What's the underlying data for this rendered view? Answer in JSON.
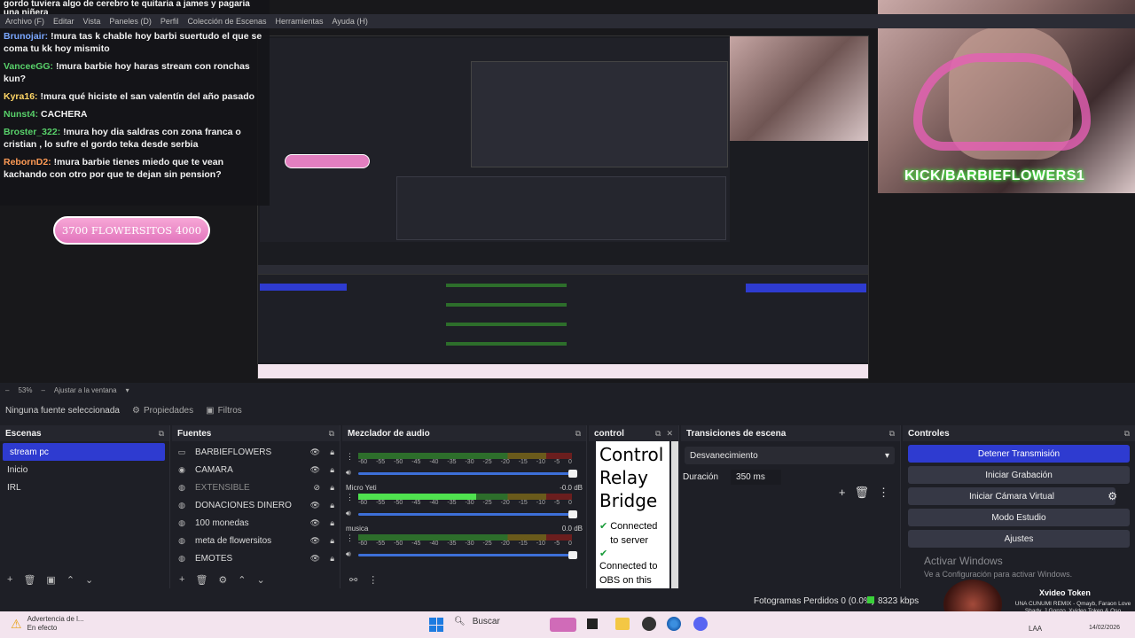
{
  "menubar": {
    "items": [
      "Archivo (F)",
      "Editar",
      "Vista",
      "Paneles (D)",
      "Perfil",
      "Colección de Escenas",
      "Herramientas",
      "Ayuda (H)"
    ]
  },
  "chat": {
    "top_fragment": "gordo tuviera algo de cerebro te quitaria a james y pagaria una niñera",
    "messages": [
      {
        "user": "Brunojair:",
        "user_color": "#7aa7ff",
        "text": "!mura tas k chable hoy barbi suertudo el que se coma tu kk hoy mismito"
      },
      {
        "user": "VanceeGG:",
        "user_color": "#58d16a",
        "text": "!mura barbie hoy haras stream con ronchas kun?"
      },
      {
        "user": "Kyra16:",
        "user_color": "#ffd666",
        "text": "!mura qué hiciste el san valentín del año pasado"
      },
      {
        "user": "Nunst4:",
        "user_color": "#58d16a",
        "text": "CACHERA"
      },
      {
        "user": "Broster_322:",
        "user_color": "#58d16a",
        "text": "!mura hoy dia saldras con zona franca o cristian , lo sufre el gordo teka desde serbia"
      },
      {
        "user": "RebornD2:",
        "user_color": "#ff9b55",
        "text": "!mura barbie tienes miedo que te vean kachando con otro por que te dejan sin pension?"
      }
    ]
  },
  "overlay": {
    "goal_pill": "3700 FLOWERSITOS 4000",
    "webcam_caption": "KICK/BARBIEFLOWERS1"
  },
  "preview_bar": {
    "zoom": "53%",
    "fit_label": "Ajustar a la ventana"
  },
  "propbar": {
    "no_source": "Ninguna fuente seleccionada",
    "properties": "Propiedades",
    "filters": "Filtros"
  },
  "scenes": {
    "title": "Escenas",
    "items": [
      "stream pc",
      "Inicio",
      "IRL"
    ],
    "active_index": 0
  },
  "sources": {
    "title": "Fuentes",
    "items": [
      {
        "name": "BARBIEFLOWERS",
        "icon": "monitor-icon",
        "visible": true
      },
      {
        "name": "CAMARA",
        "icon": "camera-icon",
        "visible": true
      },
      {
        "name": "EXTENSIBLE",
        "icon": "globe-icon",
        "visible": false
      },
      {
        "name": "DONACIONES DINERO",
        "icon": "globe-icon",
        "visible": true
      },
      {
        "name": "100 monedas",
        "icon": "globe-icon",
        "visible": true
      },
      {
        "name": "meta de flowersitos",
        "icon": "globe-icon",
        "visible": true
      },
      {
        "name": "EMOTES",
        "icon": "globe-icon",
        "visible": true
      }
    ]
  },
  "mixer": {
    "title": "Mezclador de audio",
    "ticks": [
      "-60",
      "-55",
      "-50",
      "-45",
      "-40",
      "-35",
      "-30",
      "-25",
      "-20",
      "-15",
      "-10",
      "-5",
      "0"
    ],
    "channels": [
      {
        "name": "",
        "db": "",
        "level": 0.0
      },
      {
        "name": "Micro Yeti",
        "db": "-0.0 dB",
        "level": 0.55
      },
      {
        "name": "musica",
        "db": "0.0 dB",
        "level": 0.0
      }
    ]
  },
  "control": {
    "title": "control",
    "heading": "Control Relay Bridge",
    "status1": "Connected to server",
    "status2": "Connected to OBS on this"
  },
  "transitions": {
    "title": "Transiciones de escena",
    "selected": "Desvanecimiento",
    "duration_label": "Duración",
    "duration_value": "350 ms"
  },
  "controls": {
    "title": "Controles",
    "buttons": [
      "Detener Transmisión",
      "Iniciar Grabación",
      "Iniciar Cámara Virtual",
      "Modo Estudio",
      "Ajustes"
    ],
    "watermark_title": "Activar Windows",
    "watermark_sub": "Ve a Configuración para activar Windows."
  },
  "statusbar": {
    "frames": "Fotogramas Perdidos 0 (0.0%)",
    "bitrate": "8323 kbps"
  },
  "notification": {
    "title": "Xvideo Token",
    "body": "UNA CUNUMI REMIX - Qmayb, Faraon Love Shady, J Gonzo, Xvideo Token & Oso"
  },
  "taskbar": {
    "warning_title": "Advertencia de l...",
    "warning_sub": "En efecto",
    "search": "Buscar",
    "lang": "LAA",
    "date": "14/02/2026"
  }
}
